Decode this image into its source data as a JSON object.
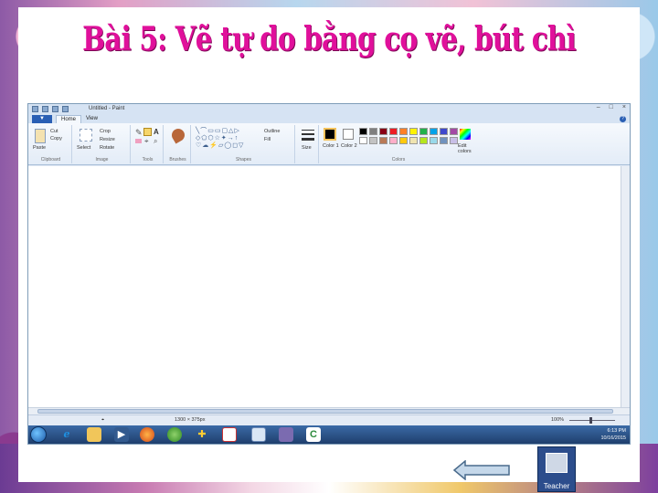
{
  "slide": {
    "title": "Bài 5: Vẽ tự do bằng cọ vẽ, bút chì"
  },
  "paint": {
    "window_title": "Untitled - Paint",
    "tabs": [
      "Home",
      "View"
    ],
    "groups": {
      "clipboard": {
        "label": "Clipboard",
        "paste": "Paste",
        "cut": "Cut",
        "copy": "Copy"
      },
      "image": {
        "label": "Image",
        "select": "Select",
        "crop": "Crop",
        "resize": "Resize",
        "rotate": "Rotate"
      },
      "tools": {
        "label": "Tools"
      },
      "brushes": {
        "label": "Brushes"
      },
      "shapes": {
        "label": "Shapes",
        "outline": "Outline",
        "fill": "Fill"
      },
      "size": {
        "label": "Size"
      },
      "colors": {
        "label": "Colors",
        "color1": "Color 1",
        "color2": "Color 2",
        "edit": "Edit colors"
      }
    },
    "palette": [
      "#000000",
      "#7f7f7f",
      "#880015",
      "#ed1c24",
      "#ff7f27",
      "#fff200",
      "#22b14c",
      "#00a2e8",
      "#3f48cc",
      "#a349a4",
      "#ffffff",
      "#c3c3c3",
      "#b97a57",
      "#ffaec9",
      "#ffc90e",
      "#efe4b0",
      "#b5e61d",
      "#99d9ea",
      "#7092be",
      "#c8bfe7"
    ],
    "status": {
      "size": "1300 × 375px",
      "zoom": "100%"
    }
  },
  "taskbar": {
    "time": "6:13 PM",
    "date": "10/16/2015"
  },
  "teacher": {
    "label": "Teacher"
  }
}
